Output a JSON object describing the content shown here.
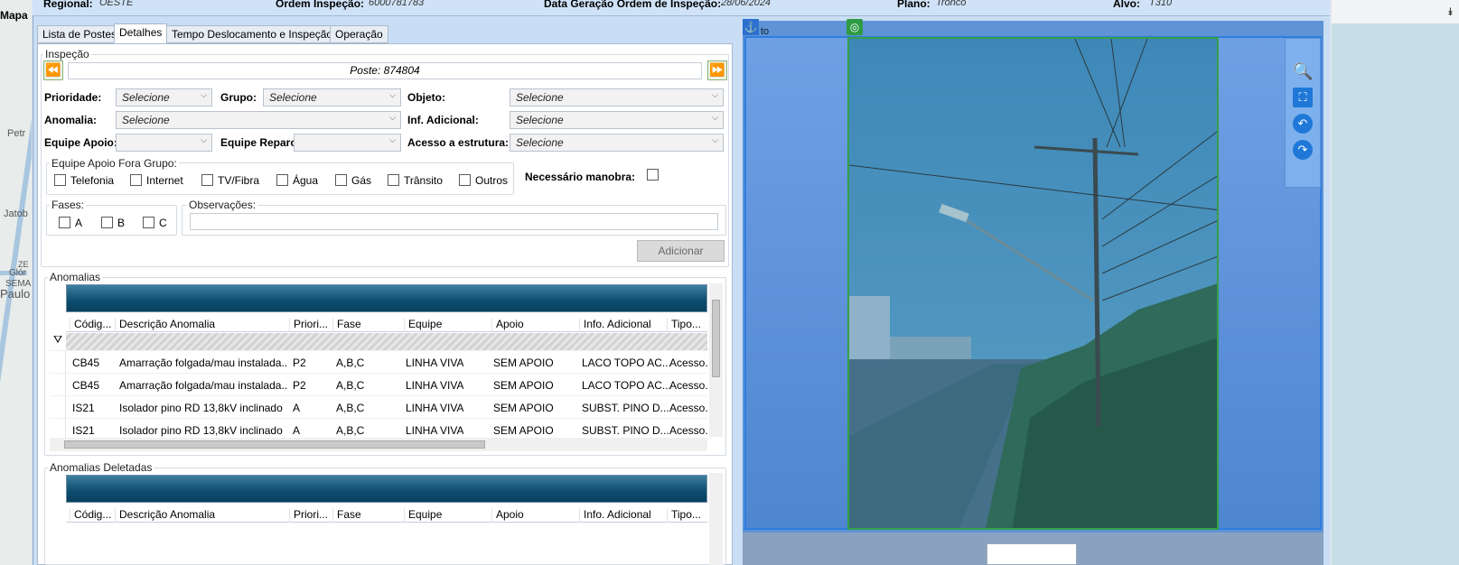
{
  "header": {
    "regional_label": "Regional:",
    "regional_value": "OESTE",
    "ordem_label": "Ordem Inspeção:",
    "ordem_value": "6000781783",
    "data_label": "Data Geração Ordem de Inspeção:",
    "data_value": "28/06/2024",
    "plano_label": "Plano:",
    "plano_value": "Tronco",
    "alvo_label": "Alvo:",
    "alvo_value": "T310"
  },
  "map": {
    "title": "Mapa",
    "labels": [
      "Petr",
      "Jatob",
      "ZE",
      "Glór",
      "SEMA",
      "Paulo"
    ]
  },
  "tabs": [
    {
      "label": "Lista de Postes"
    },
    {
      "label": "Detalhes"
    },
    {
      "label": "Tempo Deslocamento e Inspeção"
    },
    {
      "label": "Operação"
    }
  ],
  "inspecao": {
    "group_title": "Inspeção",
    "poste": "Poste: 874804",
    "prioridade_label": "Prioridade:",
    "prioridade_value": "Selecione",
    "grupo_label": "Grupo:",
    "grupo_value": "Selecione",
    "objeto_label": "Objeto:",
    "objeto_value": "Selecione",
    "anomalia_label": "Anomalia:",
    "anomalia_value": "Selecione",
    "inf_label": "Inf. Adicional:",
    "inf_value": "Selecione",
    "equipe_apoio_label": "Equipe Apoio:",
    "equipe_apoio_value": "",
    "equipe_reparo_label": "Equipe Reparo:",
    "equipe_reparo_value": "",
    "acesso_label": "Acesso a estrutura:",
    "acesso_value": "Selecione",
    "fora_grupo_title": "Equipe Apoio Fora Grupo:",
    "fora_grupo": [
      "Telefonia",
      "Internet",
      "TV/Fibra",
      "Água",
      "Gás",
      "Trânsito",
      "Outros"
    ],
    "manobra_label": "Necessário manobra:",
    "fases_title": "Fases:",
    "fases": [
      "A",
      "B",
      "C"
    ],
    "obs_title": "Observações:",
    "add_button": "Adicionar"
  },
  "anomalias": {
    "title": "Anomalias",
    "columns": [
      "Códig...",
      "Descrição Anomalia",
      "Priori...",
      "Fase",
      "Equipe",
      "Apoio",
      "Info. Adicional",
      "Tipo..."
    ],
    "rows": [
      [
        "CB45",
        "Amarração folgada/mau instalada...",
        "P2",
        "A,B,C",
        "LINHA VIVA",
        "SEM APOIO",
        "LACO TOPO AC...",
        "Acesso..."
      ],
      [
        "CB45",
        "Amarração folgada/mau instalada...",
        "P2",
        "A,B,C",
        "LINHA VIVA",
        "SEM APOIO",
        "LACO TOPO AC...",
        "Acesso..."
      ],
      [
        "IS21",
        "Isolador pino RD 13,8kV inclinado",
        "A",
        "A,B,C",
        "LINHA VIVA",
        "SEM APOIO",
        "SUBST. PINO D...",
        "Acesso..."
      ],
      [
        "IS21",
        "Isolador pino RD 13,8kV inclinado",
        "A",
        "A,B,C",
        "LINHA VIVA",
        "SEM APOIO",
        "SUBST. PINO D...",
        "Acesso..."
      ]
    ]
  },
  "anomalias_deletadas": {
    "title": "Anomalias Deletadas",
    "columns": [
      "Códig...",
      "Descrição Anomalia",
      "Priori...",
      "Fase",
      "Equipe",
      "Apoio",
      "Info. Adicional",
      "Tipo..."
    ]
  },
  "foto": {
    "label": "to"
  },
  "colors": {
    "accent": "#2f7de0",
    "grid_header": "#0d4c6e",
    "nav_green": "#3aa02a"
  }
}
